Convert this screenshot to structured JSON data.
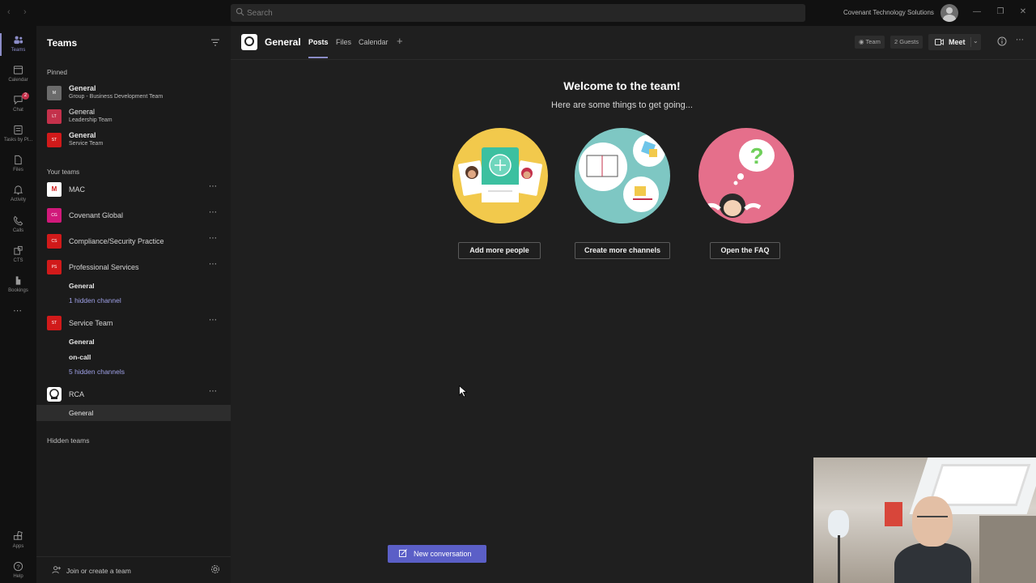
{
  "titlebar": {
    "search_placeholder": "Search",
    "org_name": "Covenant Technology Solutions"
  },
  "rail": {
    "items": [
      {
        "label": "Teams",
        "icon": "teams-icon"
      },
      {
        "label": "Calendar",
        "icon": "calendar-icon"
      },
      {
        "label": "Chat",
        "icon": "chat-icon",
        "badge": "2"
      },
      {
        "label": "Tasks by Pl...",
        "icon": "tasks-icon"
      },
      {
        "label": "Files",
        "icon": "files-icon"
      },
      {
        "label": "Activity",
        "icon": "bell-icon"
      },
      {
        "label": "Calls",
        "icon": "phone-icon"
      },
      {
        "label": "CTS",
        "icon": "cts-icon"
      },
      {
        "label": "Bookings",
        "icon": "bookings-icon"
      },
      {
        "label": "Apps",
        "icon": "apps-icon"
      },
      {
        "label": "Help",
        "icon": "help-icon"
      }
    ]
  },
  "sidebar": {
    "title": "Teams",
    "pinned_label": "Pinned",
    "pinned": [
      {
        "channel": "General",
        "team": "Group - Business Development Team",
        "tile": "M",
        "color": "#6b6b6b"
      },
      {
        "channel": "General",
        "team": "Leadership Team",
        "tile": "LT",
        "color": "#c4314b"
      },
      {
        "channel": "General",
        "team": "Service Team",
        "tile": "ST",
        "color": "#d11a1a"
      }
    ],
    "your_teams_label": "Your teams",
    "teams": [
      {
        "name": "MAC",
        "tile": "M",
        "color": "#ffffff"
      },
      {
        "name": "Covenant Global",
        "tile": "CG",
        "color": "#d1197a"
      },
      {
        "name": "Compliance/Security Practice",
        "tile": "CS",
        "color": "#d11a1a"
      },
      {
        "name": "Professional Services",
        "tile": "PS",
        "color": "#d11a1a"
      },
      {
        "name": "Service Team",
        "tile": "ST",
        "color": "#d11a1a"
      },
      {
        "name": "RCA",
        "tile": "",
        "color": "#ffffff"
      }
    ],
    "ps_channels": {
      "general": "General",
      "hidden": "1 hidden channel"
    },
    "st_channels": {
      "general": "General",
      "oncall": "on-call",
      "hidden": "5 hidden channels"
    },
    "rca_channels": {
      "general": "General"
    },
    "hidden_teams_label": "Hidden teams",
    "join_label": "Join or create a team"
  },
  "channel_header": {
    "title": "General",
    "tabs": [
      "Posts",
      "Files",
      "Calendar"
    ],
    "team_label": "Team",
    "guests_label": "2 Guests",
    "meet_label": "Meet"
  },
  "welcome": {
    "title": "Welcome to the team!",
    "subtitle": "Here are some things to get going...",
    "actions": [
      "Add more people",
      "Create more channels",
      "Open the FAQ"
    ]
  },
  "composer": {
    "new_conversation": "New conversation"
  },
  "colors": {
    "accent": "#5b5fc7",
    "accent_light": "#8b8cc7",
    "link": "#9ea0e6",
    "badge": "#c4314b"
  }
}
